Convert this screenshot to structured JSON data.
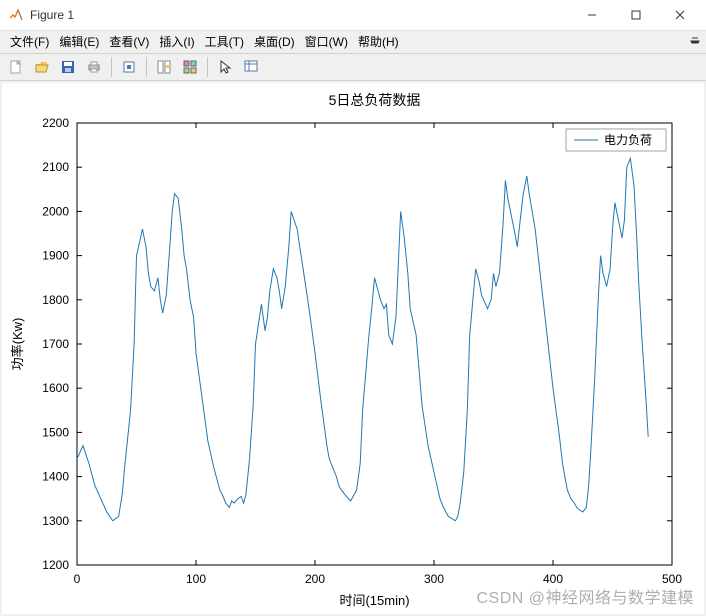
{
  "window": {
    "title": "Figure 1"
  },
  "menu": {
    "items": [
      "文件(F)",
      "编辑(E)",
      "查看(V)",
      "插入(I)",
      "工具(T)",
      "桌面(D)",
      "窗口(W)",
      "帮助(H)"
    ]
  },
  "toolbar": {
    "icons": [
      "new",
      "open",
      "save",
      "print",
      "",
      "copy-figure",
      "",
      "link",
      "tile",
      "",
      "pointer",
      "data-cursor"
    ]
  },
  "watermark": "CSDN @神经网络与数学建模",
  "chart_data": {
    "type": "line",
    "title": "5日总负荷数据",
    "xlabel": "时间(15min)",
    "ylabel": "功率(Kw)",
    "legend": [
      "电力负荷"
    ],
    "legend_pos": "upper right",
    "xlim": [
      0,
      500
    ],
    "ylim": [
      1200,
      2200
    ],
    "xticks": [
      0,
      100,
      200,
      300,
      400,
      500
    ],
    "yticks": [
      1200,
      1300,
      1400,
      1500,
      1600,
      1700,
      1800,
      1900,
      2000,
      2100,
      2200
    ],
    "series": [
      {
        "name": "电力负荷",
        "color": "#1f77b4",
        "x": [
          0,
          5,
          10,
          15,
          20,
          25,
          30,
          35,
          38,
          40,
          45,
          48,
          50,
          55,
          58,
          60,
          62,
          65,
          68,
          70,
          72,
          75,
          78,
          80,
          82,
          85,
          88,
          90,
          92,
          95,
          98,
          100,
          105,
          110,
          115,
          118,
          120,
          122,
          125,
          128,
          130,
          132,
          135,
          138,
          140,
          142,
          145,
          148,
          150,
          155,
          158,
          160,
          162,
          165,
          168,
          170,
          172,
          175,
          178,
          180,
          185,
          190,
          195,
          200,
          205,
          210,
          212,
          215,
          218,
          220,
          222,
          225,
          228,
          230,
          235,
          238,
          240,
          245,
          248,
          250,
          252,
          255,
          258,
          260,
          262,
          265,
          268,
          270,
          272,
          275,
          278,
          280,
          285,
          290,
          295,
          300,
          305,
          308,
          310,
          312,
          315,
          318,
          320,
          322,
          325,
          328,
          330,
          335,
          338,
          340,
          345,
          348,
          350,
          352,
          355,
          358,
          360,
          362,
          365,
          368,
          370,
          372,
          375,
          378,
          380,
          385,
          390,
          395,
          400,
          405,
          408,
          410,
          412,
          415,
          418,
          420,
          422,
          425,
          428,
          430,
          432,
          435,
          438,
          440,
          442,
          445,
          448,
          450,
          452,
          455,
          458,
          460,
          462,
          465,
          468,
          470,
          472,
          475,
          478,
          480
        ],
        "y": [
          1440,
          1470,
          1430,
          1380,
          1350,
          1320,
          1300,
          1310,
          1360,
          1420,
          1550,
          1700,
          1900,
          1960,
          1920,
          1860,
          1830,
          1820,
          1850,
          1800,
          1770,
          1810,
          1920,
          2000,
          2040,
          2030,
          1960,
          1900,
          1870,
          1800,
          1760,
          1680,
          1580,
          1480,
          1420,
          1390,
          1370,
          1360,
          1340,
          1330,
          1345,
          1340,
          1350,
          1355,
          1340,
          1360,
          1440,
          1560,
          1700,
          1790,
          1730,
          1760,
          1820,
          1870,
          1850,
          1820,
          1780,
          1830,
          1920,
          2000,
          1960,
          1870,
          1780,
          1680,
          1570,
          1470,
          1440,
          1420,
          1400,
          1380,
          1370,
          1360,
          1350,
          1345,
          1370,
          1430,
          1550,
          1710,
          1790,
          1850,
          1830,
          1800,
          1780,
          1790,
          1720,
          1700,
          1760,
          1880,
          2000,
          1940,
          1860,
          1780,
          1720,
          1560,
          1470,
          1410,
          1350,
          1330,
          1320,
          1310,
          1305,
          1300,
          1310,
          1340,
          1410,
          1550,
          1720,
          1870,
          1840,
          1810,
          1780,
          1800,
          1860,
          1830,
          1860,
          1970,
          2070,
          2030,
          1990,
          1950,
          1920,
          1970,
          2040,
          2080,
          2040,
          1960,
          1840,
          1720,
          1600,
          1500,
          1430,
          1400,
          1370,
          1350,
          1340,
          1330,
          1325,
          1320,
          1330,
          1380,
          1470,
          1620,
          1800,
          1900,
          1860,
          1830,
          1870,
          1960,
          2020,
          1980,
          1940,
          1980,
          2100,
          2120,
          2060,
          1960,
          1840,
          1700,
          1580,
          1490
        ]
      }
    ]
  }
}
